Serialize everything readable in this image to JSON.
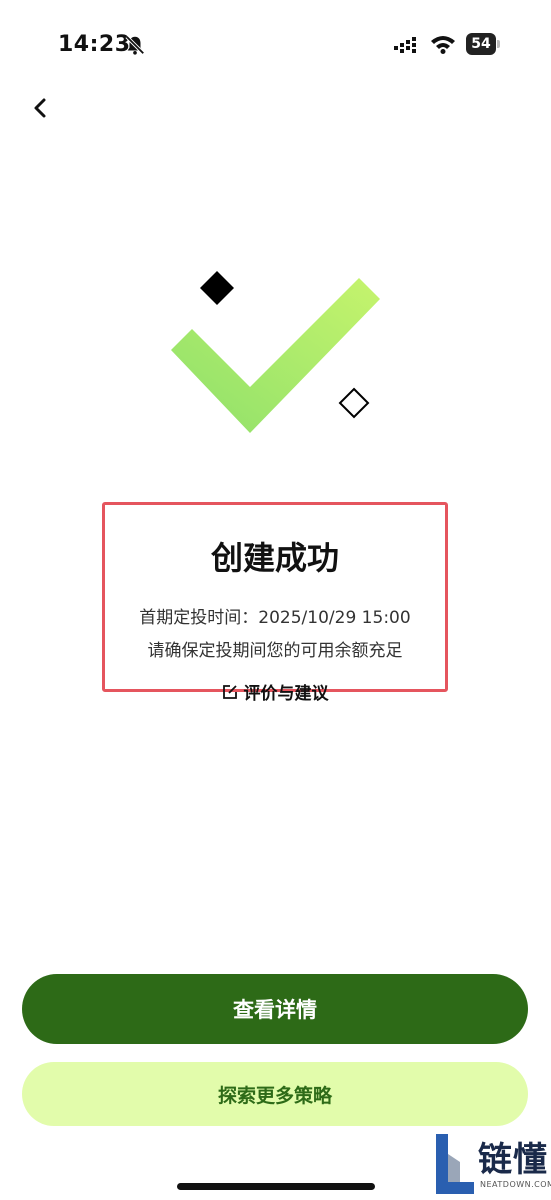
{
  "status_bar": {
    "time": "14:23",
    "battery": "54"
  },
  "hero": {
    "check_color_start": "#b8f06c",
    "check_color_end": "#8ee06a"
  },
  "result": {
    "title": "创建成功",
    "first_invest_time": "首期定投时间：2025/10/29 15:00",
    "balance_note": "请确保定投期间您的可用余额充足",
    "feedback_label": "评价与建议"
  },
  "actions": {
    "view_details_label": "查看详情",
    "explore_more_label": "探索更多策略"
  },
  "watermark": {
    "brand": "链懂",
    "domain": "NEATDOWN.COM"
  },
  "colors": {
    "primary": "#2d6a17",
    "secondary_bg": "#e2fcab",
    "highlight_border": "#e5555e"
  }
}
